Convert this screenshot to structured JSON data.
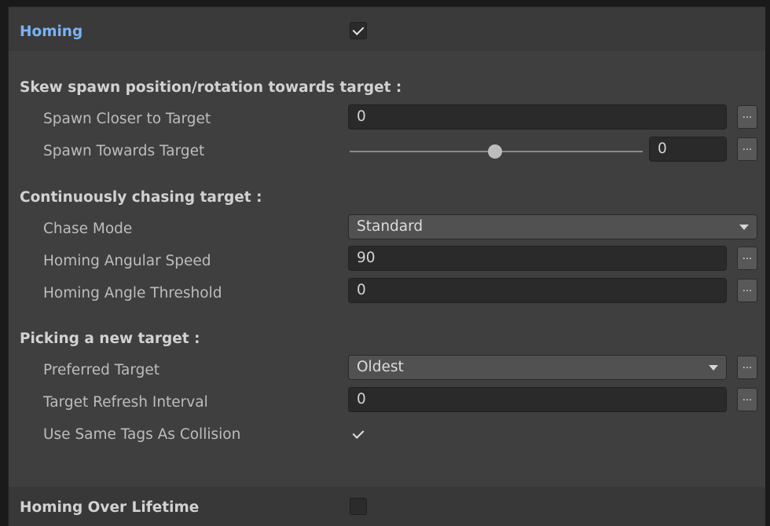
{
  "homing": {
    "title": "Homing",
    "enabled": true
  },
  "skew": {
    "heading": "Skew spawn position/rotation towards target :",
    "spawn_closer": {
      "label": "Spawn Closer to Target",
      "value": "0",
      "more": "..."
    },
    "spawn_towards": {
      "label": "Spawn Towards Target",
      "value": "0",
      "slider_fraction": 0.5,
      "more": "..."
    }
  },
  "chasing": {
    "heading": "Continuously chasing target :",
    "chase_mode": {
      "label": "Chase Mode",
      "value": "Standard"
    },
    "angular_speed": {
      "label": "Homing Angular Speed",
      "value": "90",
      "more": "..."
    },
    "angle_threshold": {
      "label": "Homing Angle Threshold",
      "value": "0",
      "more": "..."
    }
  },
  "picking": {
    "heading": "Picking a new target :",
    "preferred_target": {
      "label": "Preferred Target",
      "value": "Oldest",
      "more": "..."
    },
    "refresh_interval": {
      "label": "Target Refresh Interval",
      "value": "0",
      "more": "..."
    },
    "same_tags": {
      "label": "Use Same Tags As Collision",
      "checked": true
    }
  },
  "lifetime": {
    "label": "Homing Over Lifetime",
    "checked": false
  },
  "colors": {
    "title": "#7bb2f4",
    "panel": "#3f3f3f",
    "field": "#2a2a2a"
  }
}
